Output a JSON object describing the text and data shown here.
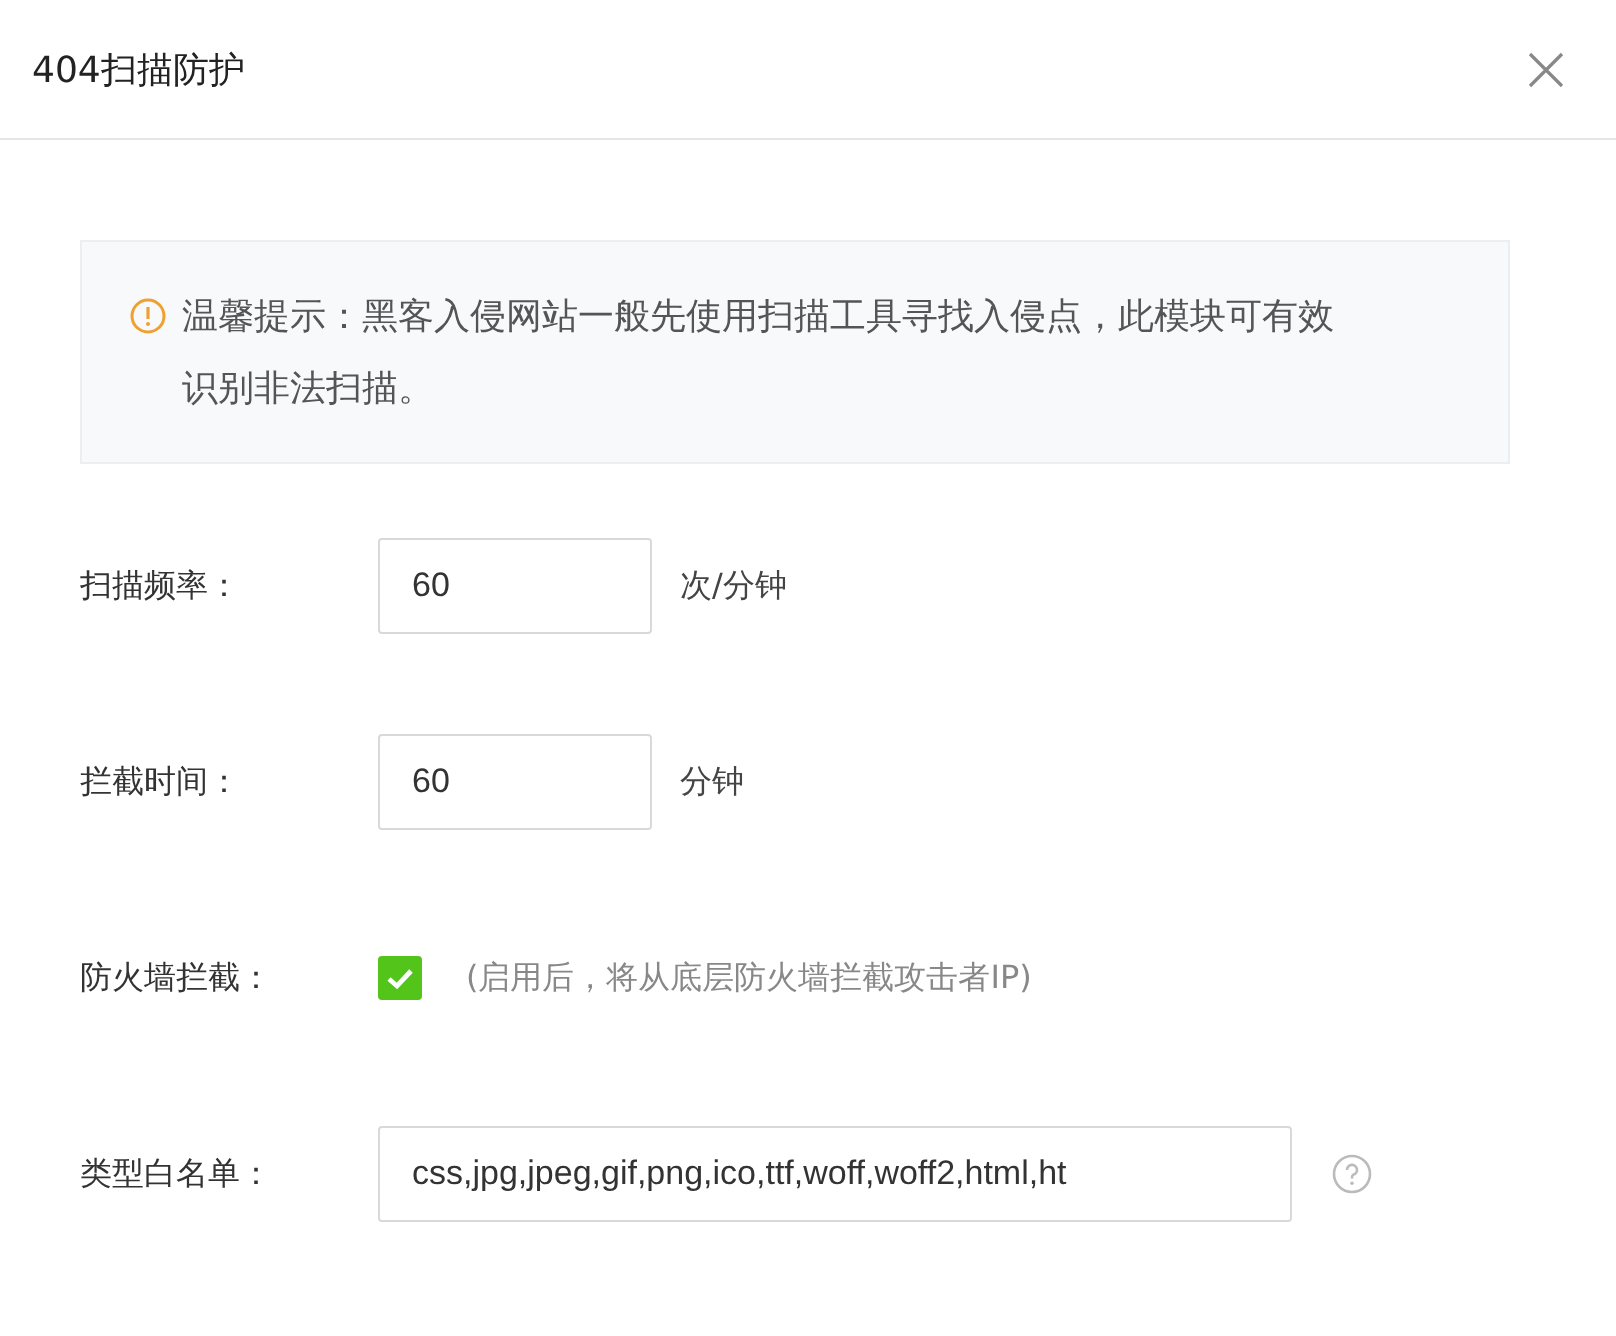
{
  "dialog": {
    "title": "404扫描防护"
  },
  "notice": {
    "text": "温馨提示：黑客入侵网站一般先使用扫描工具寻找入侵点，此模块可有效识别非法扫描。"
  },
  "fields": [
    {
      "kind": "number",
      "label": "扫描频率：",
      "value": "60",
      "unit": "次/分钟"
    },
    {
      "kind": "number",
      "label": "拦截时间：",
      "value": "60",
      "unit": "分钟"
    },
    {
      "kind": "checkbox",
      "label": "防火墙拦截：",
      "checked": true,
      "hint": "(启用后，将从底层防火墙拦截攻击者IP)"
    },
    {
      "kind": "text",
      "label": "类型白名单：",
      "value": "css,jpg,jpeg,gif,png,ico,ttf,woff,woff2,html,ht",
      "help": true
    }
  ]
}
